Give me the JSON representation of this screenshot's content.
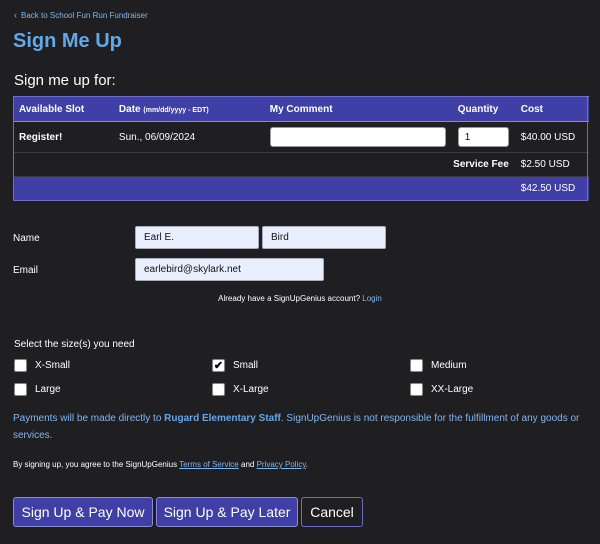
{
  "back_link": {
    "label": "Back to School Fun Run Fundraiser"
  },
  "page_title": "Sign Me Up",
  "signup_for": "Sign me up for:",
  "table": {
    "headers": {
      "slot": "Available Slot",
      "date": "Date",
      "date_format": "(mm/dd/yyyy - EDT)",
      "comment": "My Comment",
      "quantity": "Quantity",
      "cost": "Cost"
    },
    "row": {
      "slot": "Register!",
      "date": "Sun., 06/09/2024",
      "comment": "",
      "quantity": "1",
      "cost": "$40.00 USD"
    },
    "service_fee": {
      "label": "Service Fee",
      "amount": "$2.50 USD"
    },
    "total": "$42.50 USD"
  },
  "form": {
    "name_label": "Name",
    "first_name": "Earl E.",
    "last_name": "Bird",
    "email_label": "Email",
    "email": "earlebird@skylark.net"
  },
  "account": {
    "prompt": "Already have a SignUpGenius account?",
    "login": "Login"
  },
  "sizes": {
    "title": "Select the size(s) you need",
    "options": [
      {
        "label": "X-Small",
        "checked": false
      },
      {
        "label": "Small",
        "checked": true
      },
      {
        "label": "Medium",
        "checked": false
      },
      {
        "label": "Large",
        "checked": false
      },
      {
        "label": "X-Large",
        "checked": false
      },
      {
        "label": "XX-Large",
        "checked": false
      }
    ]
  },
  "payments": {
    "before": "Payments will be made directly to ",
    "org": "Rugard Elementary Staff",
    "after": ". SignUpGenius is not responsible for the fulfillment of any goods or services."
  },
  "terms": {
    "before": "By signing up, you agree to the SignUpGenius ",
    "tos": "Terms of Service",
    "and": " and ",
    "privacy": "Privacy Policy",
    "end": "."
  },
  "buttons": {
    "pay_now": "Sign Up & Pay Now",
    "pay_later": "Sign Up & Pay Later",
    "cancel": "Cancel"
  },
  "colors": {
    "background": "#1f1f22",
    "accent": "#3f3fa6",
    "title": "#62a7e8",
    "link": "#7fb6f0"
  }
}
